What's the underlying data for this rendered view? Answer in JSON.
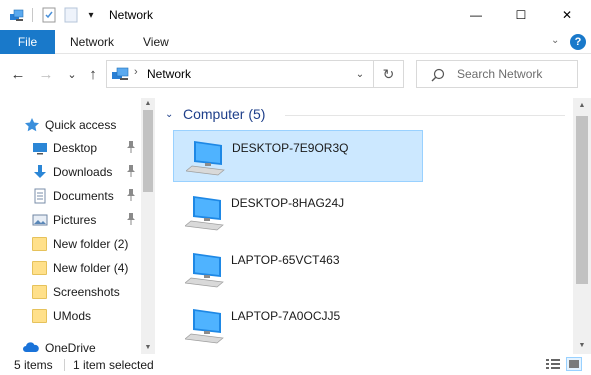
{
  "window": {
    "title": "Network",
    "minimize_glyph": "—",
    "maximize_glyph": "☐",
    "close_glyph": "✕"
  },
  "ribbon": {
    "tabs": [
      {
        "label": "File"
      },
      {
        "label": "Network"
      },
      {
        "label": "View"
      }
    ],
    "help_label": "?",
    "collapse_glyph": "⌄"
  },
  "address_bar": {
    "back_glyph": "←",
    "forward_glyph": "→",
    "recent_glyph": "⌄",
    "up_glyph": "↑",
    "path": "Network",
    "dropdown_glyph": "⌄",
    "refresh_glyph": "↻"
  },
  "search": {
    "placeholder": "Search Network"
  },
  "navigation": {
    "items": [
      {
        "label": "Quick access",
        "icon": "star-icon",
        "pinned": false
      },
      {
        "label": "Desktop",
        "icon": "desktop-icon",
        "pinned": true
      },
      {
        "label": "Downloads",
        "icon": "download-icon",
        "pinned": true
      },
      {
        "label": "Documents",
        "icon": "documents-icon",
        "pinned": true
      },
      {
        "label": "Pictures",
        "icon": "pictures-icon",
        "pinned": true
      },
      {
        "label": "New folder (2)",
        "icon": "folder-icon",
        "pinned": false
      },
      {
        "label": "New folder (4)",
        "icon": "folder-icon",
        "pinned": false
      },
      {
        "label": "Screenshots",
        "icon": "folder-icon",
        "pinned": false
      },
      {
        "label": "UMods",
        "icon": "folder-icon",
        "pinned": false
      },
      {
        "label": "OneDrive",
        "icon": "cloud-icon",
        "pinned": false
      }
    ],
    "pin_glyph": "📌"
  },
  "content": {
    "group_label": "Computer (5)",
    "group_chevron": "⌄",
    "devices": [
      {
        "name": "DESKTOP-7E9OR3Q",
        "selected": true
      },
      {
        "name": "DESKTOP-8HAG24J",
        "selected": false
      },
      {
        "name": "LAPTOP-65VCT463",
        "selected": false
      },
      {
        "name": "LAPTOP-7A0OCJJ5",
        "selected": false
      }
    ]
  },
  "status_bar": {
    "item_count": "5 items",
    "selection": "1 item selected"
  },
  "colors": {
    "accent": "#1979ca",
    "selection_bg": "#cce8ff",
    "selection_border": "#99d1ff",
    "group_header": "#1e3f8a",
    "folder": "#ffe08a"
  }
}
